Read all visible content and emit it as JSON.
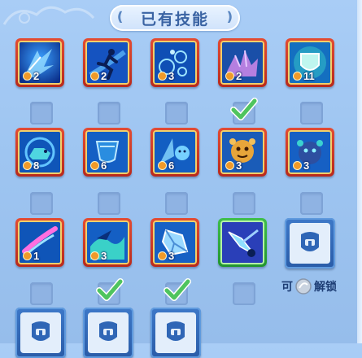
{
  "panel": {
    "title": "已有技能"
  },
  "skills": [
    {
      "id": "s1",
      "icon": "wind-dash-icon",
      "level": "2",
      "frame": "red"
    },
    {
      "id": "s2",
      "icon": "runner-icon",
      "level": "2",
      "frame": "red"
    },
    {
      "id": "s3",
      "icon": "bubbles-icon",
      "level": "3",
      "frame": "red"
    },
    {
      "id": "s4",
      "icon": "crystal-claw-icon",
      "level": "2",
      "frame": "red"
    },
    {
      "id": "s5",
      "icon": "shield-icon",
      "level": "11",
      "frame": "red"
    },
    {
      "id": "s6",
      "icon": "ice-beast-icon",
      "level": "8",
      "frame": "red"
    },
    {
      "id": "s7",
      "icon": "cup-icon",
      "level": "6",
      "frame": "red"
    },
    {
      "id": "s8",
      "icon": "ice-spirit-icon",
      "level": "6",
      "frame": "red"
    },
    {
      "id": "s9",
      "icon": "gold-golem-icon",
      "level": "3",
      "frame": "red"
    },
    {
      "id": "s10",
      "icon": "blue-golem-icon",
      "level": "3",
      "frame": "red"
    },
    {
      "id": "s11",
      "icon": "pink-slash-icon",
      "level": "1",
      "frame": "red"
    },
    {
      "id": "s12",
      "icon": "wave-icon",
      "level": "3",
      "frame": "red"
    },
    {
      "id": "s13",
      "icon": "ice-shard-icon",
      "level": "3",
      "frame": "red"
    },
    {
      "id": "s14",
      "icon": "crystal-sword-icon",
      "level": "",
      "frame": "green"
    }
  ],
  "checkboxes": [
    false,
    false,
    false,
    true,
    false,
    false,
    false,
    false,
    false,
    false,
    false,
    true,
    true,
    false
  ],
  "unlock": {
    "label_prefix": "可",
    "label_suffix": "解锁"
  },
  "colors": {
    "frame_red": "#c7321f",
    "frame_gold": "#f1d06a",
    "frame_green": "#2ea83a",
    "check_green": "#4fc45e",
    "lock_blue": "#2f66b6"
  }
}
